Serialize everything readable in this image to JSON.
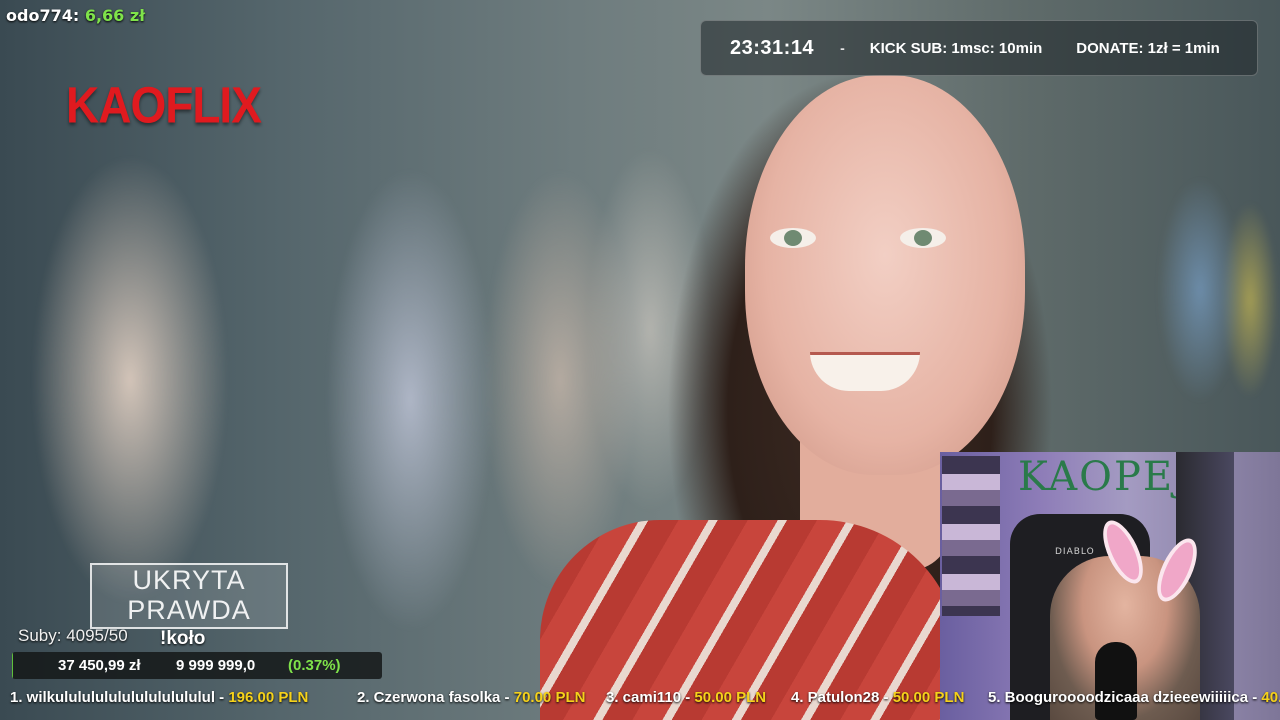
{
  "top_donor": {
    "name": "odo774:",
    "amount": "6,66 zł"
  },
  "logo": {
    "text": "KAOFLIX"
  },
  "timer": {
    "time": "23:31:14",
    "separator": "-",
    "kick_sub": "KICK SUB: 1msc: 10min",
    "donate": "DONATE: 1zł = 1min"
  },
  "tv_badge": {
    "line1": "UKRYTA",
    "line2": "PRAWDA"
  },
  "subs": {
    "text": "Suby: 4095/50"
  },
  "command": {
    "text": "!koło"
  },
  "goal": {
    "current": "37 450,99 zł",
    "target": "9 999 999,0",
    "percent_label": "(0.37%)",
    "progress_percent": 0.37
  },
  "webcam": {
    "wall_text": "KAOPEJ",
    "chair_brand": "DIABLO"
  },
  "leaderboard": [
    {
      "rank_name": "1. wilkulululululululululululul -",
      "amount": "196.00 PLN"
    },
    {
      "rank_name": "2. Czerwona fasolka -",
      "amount": "70.00 PLN"
    },
    {
      "rank_name": "3. cami110 -",
      "amount": "50.00 PLN"
    },
    {
      "rank_name": "4. Patulon28 -",
      "amount": "50.00 PLN"
    },
    {
      "rank_name": "5. Booguroooodzicaaa dzieeewiiiiica -",
      "amount": "40."
    }
  ],
  "colors": {
    "logo_red": "#e01a1f",
    "accent_green": "#7fe34a",
    "amount_yellow": "#f6d21a"
  }
}
